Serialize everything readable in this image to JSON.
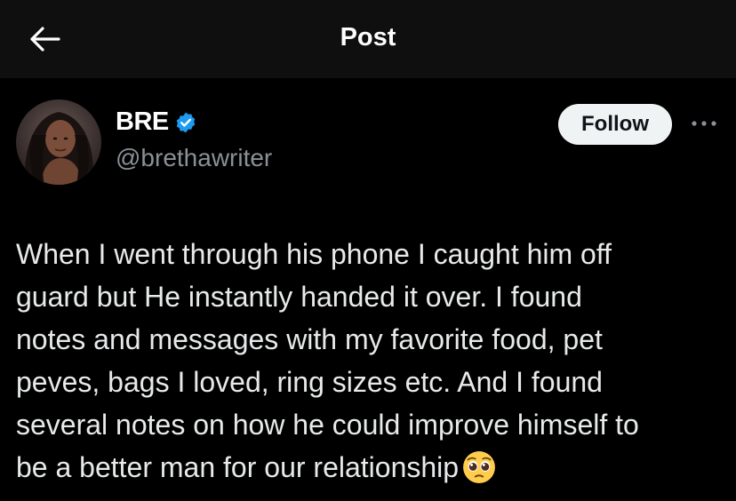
{
  "header": {
    "title": "Post",
    "back_icon": "arrow-left-icon"
  },
  "author": {
    "display_name": "BRE",
    "handle": "@brethawriter",
    "verified": true,
    "verified_color": "#1d9bf0"
  },
  "actions": {
    "follow_label": "Follow",
    "more_icon": "more-horizontal-icon"
  },
  "post": {
    "lines": [
      "When I went through his phone I caught him off",
      "guard but He instantly handed it over. I found",
      "notes and messages with my favorite food, pet",
      "peves, bags I loved, ring sizes etc. And I found",
      "several notes on how he could improve himself to",
      "be a better man for our relationship"
    ],
    "trailing_emoji": "pleading-face-emoji"
  },
  "colors": {
    "background": "#000000",
    "header_background": "#0f0f0f",
    "text": "#e7e9ea",
    "muted": "#8b9096",
    "follow_bg": "#eff3f4"
  }
}
